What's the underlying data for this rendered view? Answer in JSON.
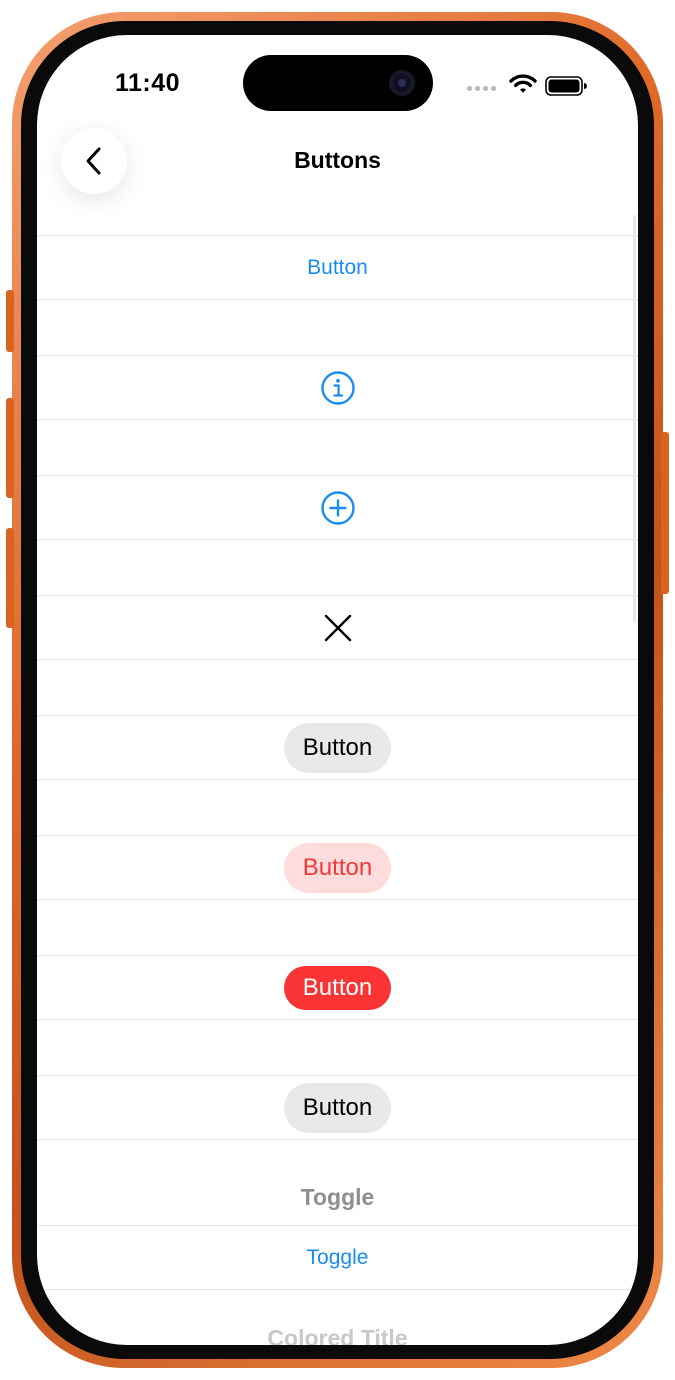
{
  "status_bar": {
    "time": "11:40"
  },
  "nav": {
    "title": "Buttons",
    "back_icon": "chevron-left-icon"
  },
  "rows": [
    {
      "kind": "text",
      "label": "Button",
      "color": "#1a8cf0"
    },
    {
      "kind": "icon",
      "icon": "info-circle-icon",
      "color": "#1a8cf0"
    },
    {
      "kind": "icon",
      "icon": "plus-circle-icon",
      "color": "#1a8cf0"
    },
    {
      "kind": "icon",
      "icon": "close-x-icon",
      "color": "#000000"
    },
    {
      "kind": "pill",
      "label": "Button",
      "style": "gray"
    },
    {
      "kind": "pill",
      "label": "Button",
      "style": "tinted-red"
    },
    {
      "kind": "pill",
      "label": "Button",
      "style": "filled-red"
    },
    {
      "kind": "pill",
      "label": "Button",
      "style": "gray"
    }
  ],
  "toggle_section": {
    "title": "Toggle",
    "toggle_label": "Toggle"
  },
  "colored_title_section": {
    "title": "Colored Title"
  },
  "colors": {
    "accent": "#1a8cf0",
    "destructive": "#fa3434",
    "frame": "#e06a2a"
  }
}
